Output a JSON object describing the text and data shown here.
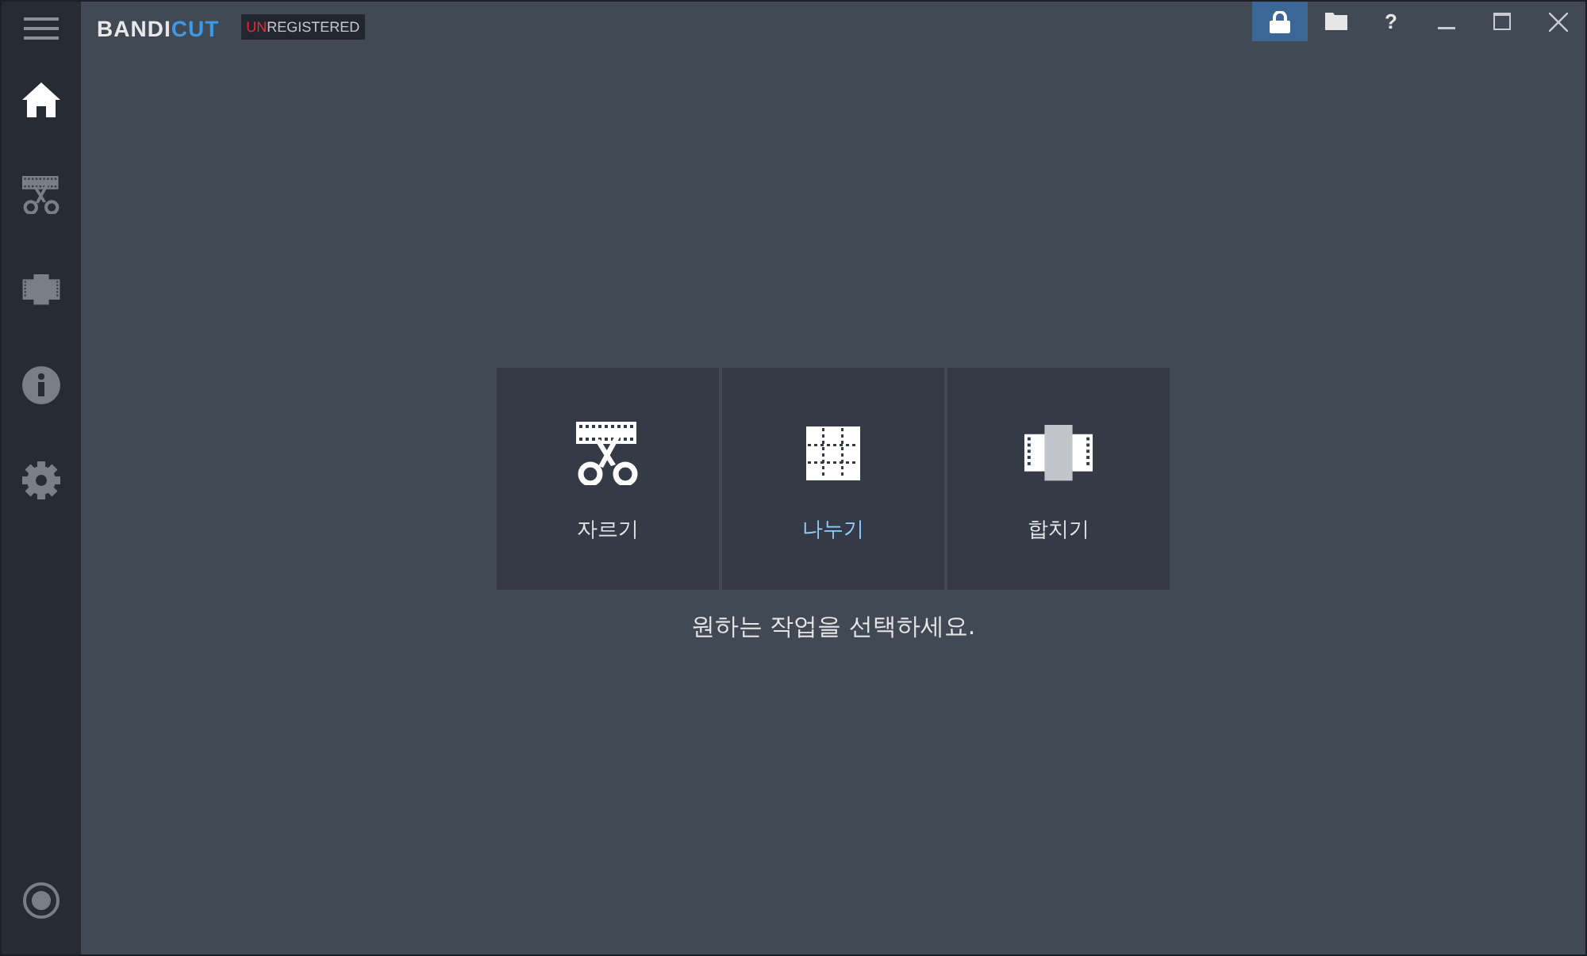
{
  "app": {
    "logo_part_1": "BANDI",
    "logo_part_2": "CUT",
    "badge_part_1": "UN",
    "badge_part_2": "REGISTERED"
  },
  "toolbar": [
    {
      "kind": "lock",
      "active": true
    },
    {
      "kind": "folder",
      "active": false
    },
    {
      "kind": "help",
      "label": "?",
      "active": false
    }
  ],
  "sidebar": {
    "items": [
      {
        "kind": "home",
        "selected": true
      },
      {
        "kind": "cut",
        "selected": false
      },
      {
        "kind": "join",
        "selected": false
      },
      {
        "kind": "info",
        "selected": false
      },
      {
        "kind": "settings",
        "selected": false
      }
    ]
  },
  "tasks": [
    {
      "kind": "cut",
      "label": "자르기",
      "selected": false
    },
    {
      "kind": "split",
      "label": "나누기",
      "selected": true
    },
    {
      "kind": "join",
      "label": "합치기",
      "selected": false
    }
  ],
  "prompt": "원하는 작업을 선택하세요."
}
